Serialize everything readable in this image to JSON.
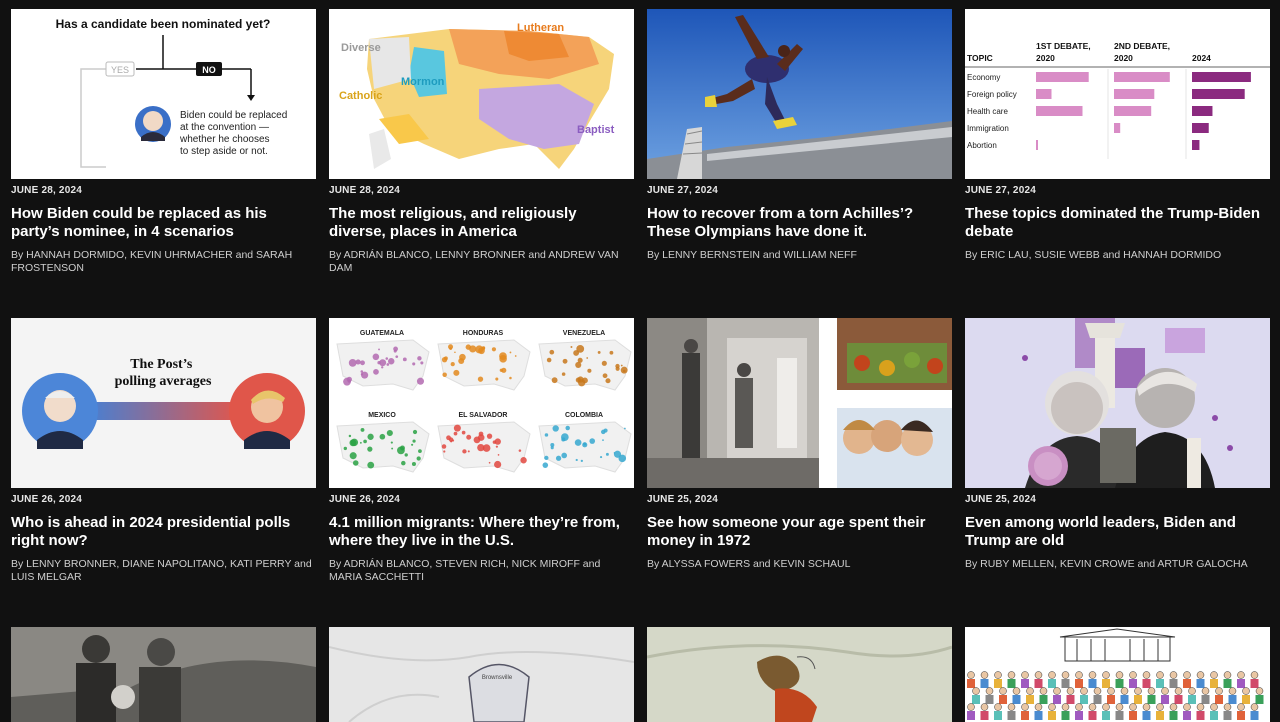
{
  "articles": [
    {
      "date": "JUNE 28, 2024",
      "title": "How Biden could be replaced as his party’s nominee, in 4 scenarios",
      "byline": "By HANNAH DORMIDO, KEVIN UHRMACHER and SARAH FROSTENSON",
      "thumb": {
        "question": "Has a candidate been nominated yet?",
        "yes": "YES",
        "no": "NO",
        "note": [
          "Biden could be replaced",
          "at the convention —",
          "whether he chooses",
          "to step aside or not."
        ]
      }
    },
    {
      "date": "JUNE 28, 2024",
      "title": "The most religious, and religiously diverse, places in America",
      "byline": "By ADRIÁN BLANCO, LENNY BRONNER and ANDREW VAN DAM",
      "thumb": {
        "labels": [
          "Diverse",
          "Lutheran",
          "Mormon",
          "Catholic",
          "Baptist"
        ]
      }
    },
    {
      "date": "JUNE 27, 2024",
      "title": "How to recover from a torn Achilles’? These Olympians have done it.",
      "byline": "By LENNY BERNSTEIN and WILLIAM NEFF",
      "thumb": {}
    },
    {
      "date": "JUNE 27, 2024",
      "title": "These topics dominated the Trump-Biden debate",
      "byline": "By ERIC LAU, SUSIE WEBB and HANNAH DORMIDO",
      "thumb": {
        "topic_header": "TOPIC",
        "col1": [
          "1ST DEBATE,",
          "2020"
        ],
        "col2": [
          "2ND DEBATE,",
          "2020"
        ],
        "col3": "2024",
        "topics": [
          "Economy",
          "Foreign policy",
          "Health care",
          "Immigration",
          "Abortion"
        ],
        "values_1": [
          0.85,
          0.25,
          0.75,
          0.0,
          0.03
        ],
        "values_2": [
          0.9,
          0.65,
          0.6,
          0.1,
          0.0
        ],
        "values_3": [
          0.95,
          0.85,
          0.33,
          0.27,
          0.12
        ],
        "color_light": "#d98cc6",
        "color_dark": "#8b2a7f"
      }
    },
    {
      "date": "JUNE 26, 2024",
      "title": "Who is ahead in 2024 presidential polls right now?",
      "byline": "By LENNY BRONNER, DIANE NAPOLITANO, KATI PERRY and LUIS MELGAR",
      "thumb": {
        "title": [
          "The Post’s",
          "polling averages"
        ]
      }
    },
    {
      "date": "JUNE 26, 2024",
      "title": "4.1 million migrants: Where they’re from, where they live in the U.S.",
      "byline": "By ADRIÁN BLANCO, STEVEN RICH, NICK MIROFF and MARIA SACCHETTI",
      "thumb": {
        "countries": [
          "GUATEMALA",
          "HONDURAS",
          "VENEZUELA",
          "MEXICO",
          "EL SALVADOR",
          "COLOMBIA"
        ],
        "colors": [
          "#b36ab0",
          "#e38a1e",
          "#c8781c",
          "#2aa244",
          "#e2483f",
          "#36a8d0"
        ]
      }
    },
    {
      "date": "JUNE 25, 2024",
      "title": "See how someone your age spent their money in 1972",
      "byline": "By ALYSSA FOWERS and KEVIN SCHAUL",
      "thumb": {}
    },
    {
      "date": "JUNE 25, 2024",
      "title": "Even among world leaders, Biden and Trump are old",
      "byline": "By RUBY MELLEN, KEVIN CROWE and ARTUR GALOCHA",
      "thumb": {}
    }
  ],
  "partial_row": [
    {
      "thumb_label": ""
    },
    {
      "thumb_label": "Brownsville"
    },
    {
      "thumb_label": ""
    },
    {
      "thumb_label": ""
    }
  ]
}
